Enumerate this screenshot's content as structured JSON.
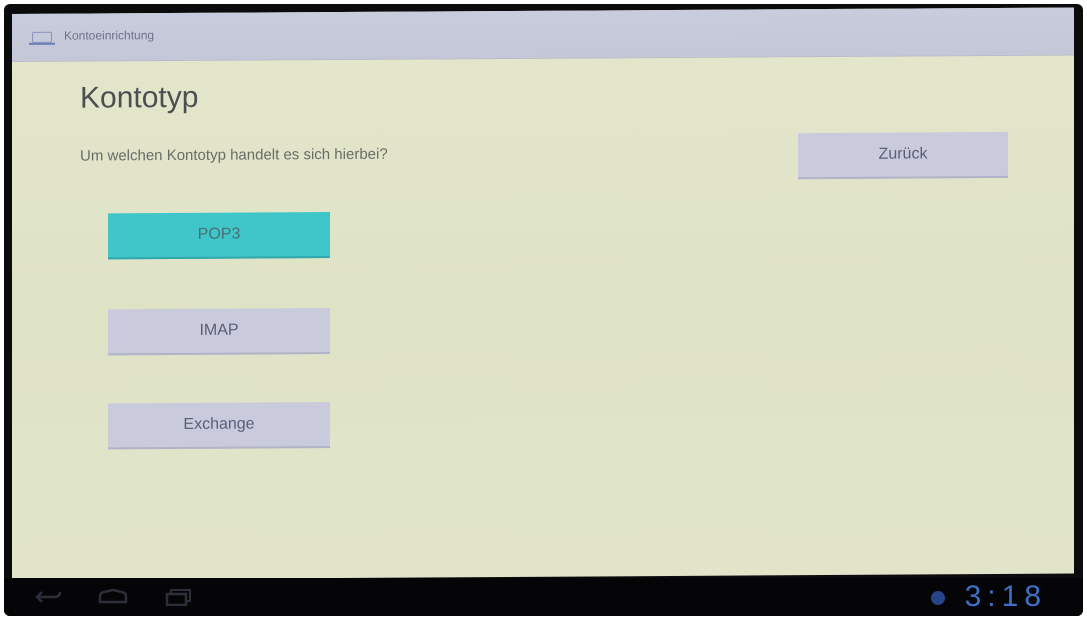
{
  "actionbar": {
    "title": "Kontoeinrichtung",
    "icon": "mail-icon"
  },
  "page": {
    "title": "Kontotyp",
    "question": "Um welchen Kontotyp handelt es sich hierbei?"
  },
  "buttons": {
    "back": "Zurück",
    "pop3": "POP3",
    "imap": "IMAP",
    "exchange": "Exchange"
  },
  "navbar": {
    "clock": "3:18"
  },
  "colors": {
    "screen_bg": "#e1e4c9",
    "actionbar_bg": "#c9ccdc",
    "button_bg": "#c9cadc",
    "button_selected": "#3fc6c9",
    "clock": "#3f6fc4"
  }
}
